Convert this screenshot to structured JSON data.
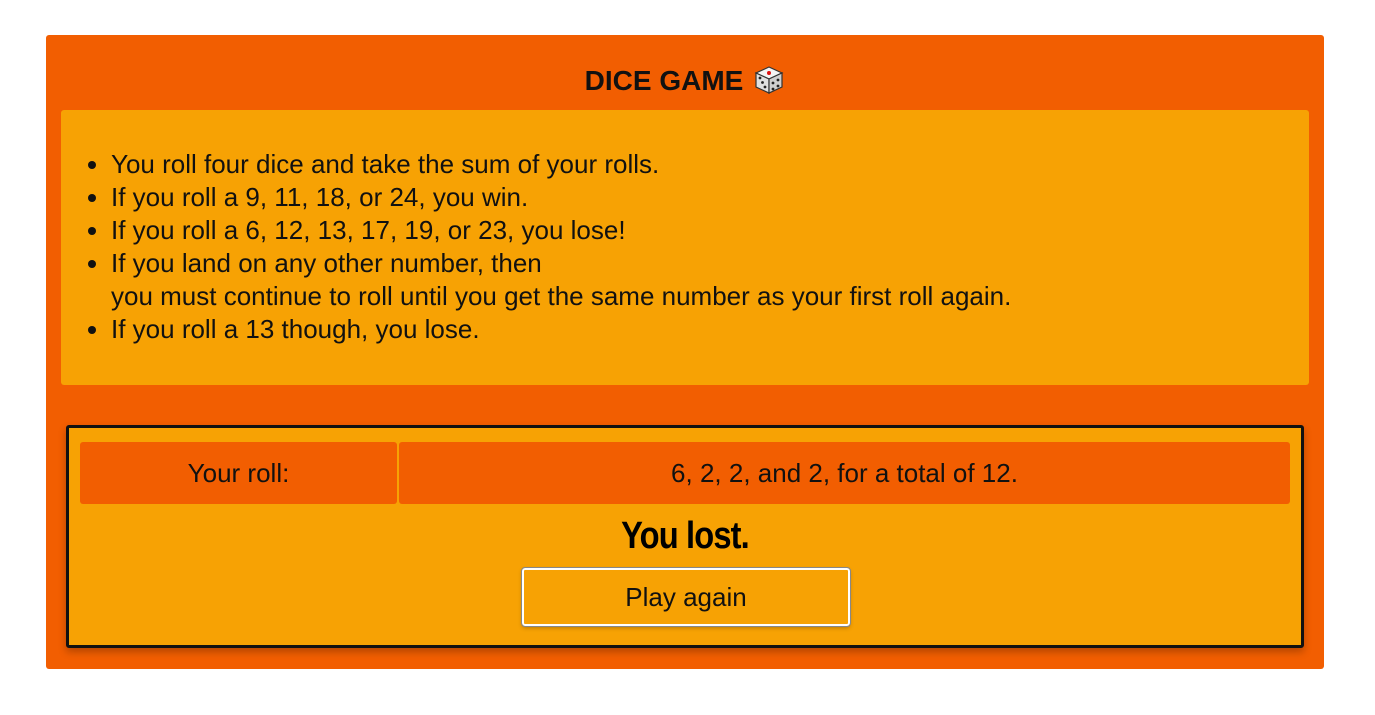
{
  "header": {
    "title": "DICE GAME",
    "title_icon": "die-icon"
  },
  "rules": [
    {
      "line1": "You roll four dice and take the sum of your rolls.",
      "line2": ""
    },
    {
      "line1": "If you roll a 9, 11, 18, or 24, you win.",
      "line2": ""
    },
    {
      "line1": "If you roll a 6, 12, 13, 17, 19, or 23, you lose!",
      "line2": ""
    },
    {
      "line1": "If you land on any other number, then",
      "line2": "you must continue to roll until you get the same number as your first roll again."
    },
    {
      "line1": "If you roll a 13 though, you lose.",
      "line2": ""
    }
  ],
  "result": {
    "roll_label": "Your roll:",
    "roll_value": "6, 2, 2, and 2, for a total of 12.",
    "message": "You lost.",
    "play_again_label": "Play again"
  },
  "colors": {
    "panel": "#f25e01",
    "box": "#f7a204",
    "text": "#111111",
    "border": "#111111"
  }
}
